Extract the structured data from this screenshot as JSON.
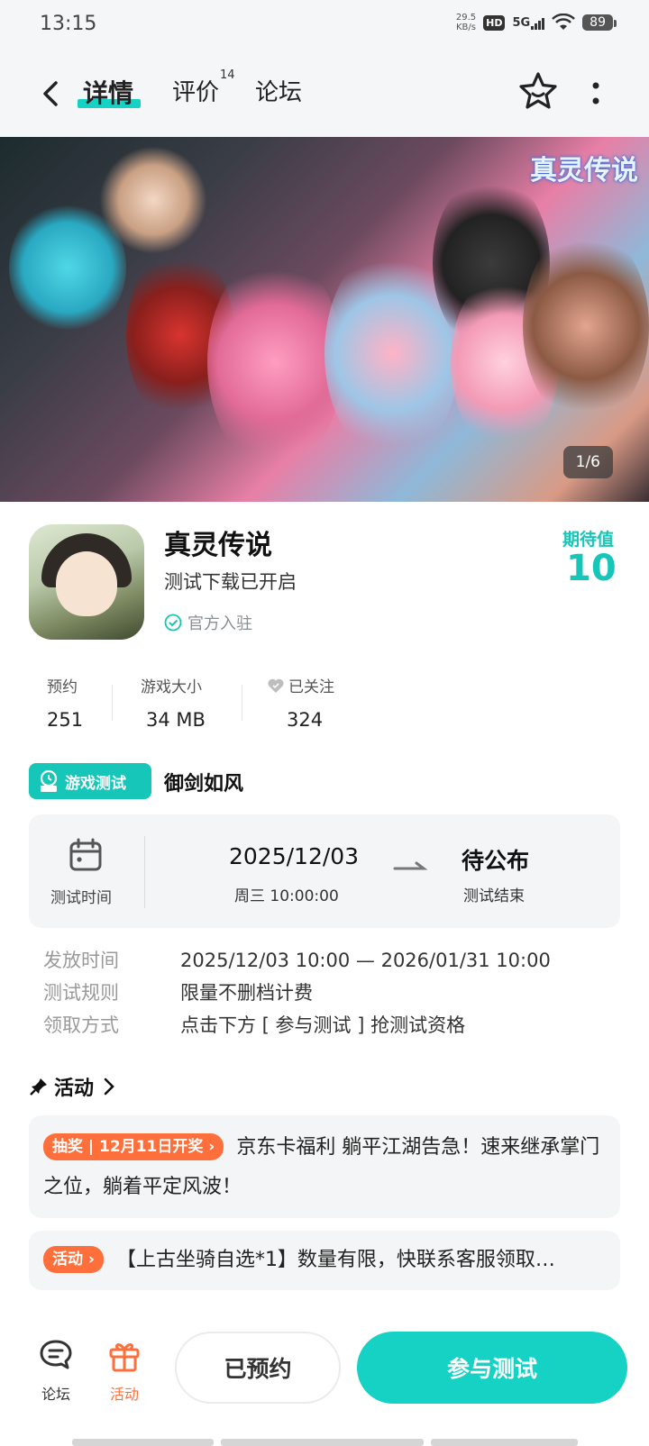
{
  "status_bar": {
    "time": "13:15",
    "speed_value": "29.5",
    "speed_unit": "KB/s",
    "hd": "HD",
    "network": "5G",
    "battery": "89"
  },
  "header": {
    "tabs": [
      {
        "label": "详情"
      },
      {
        "label": "评价",
        "count": "14"
      },
      {
        "label": "论坛"
      }
    ]
  },
  "banner": {
    "logo_text": "真灵传说",
    "counter": "1/6"
  },
  "app": {
    "name": "真灵传说",
    "subtitle": "测试下载已开启",
    "official": "官方入驻",
    "expect_label": "期待值",
    "expect_value": "10"
  },
  "stats": [
    {
      "label": "预约",
      "value": "251"
    },
    {
      "label": "游戏大小",
      "value": "34 MB"
    },
    {
      "label": "已关注",
      "value": "324"
    }
  ],
  "test": {
    "badge": "游戏测试",
    "name": "御剑如风",
    "time_label": "测试时间",
    "start_date": "2025/12/03",
    "start_detail": "周三  10:00:00",
    "end_main": "待公布",
    "end_sub": "测试结束",
    "info": [
      {
        "key": "发放时间",
        "value": "2025/12/03 10:00 — 2026/01/31 10:00"
      },
      {
        "key": "测试规则",
        "value": "限量不删档计费"
      },
      {
        "key": "领取方式",
        "value": "点击下方 [ 参与测试 ] 抢测试资格"
      }
    ]
  },
  "activity": {
    "title": "活动",
    "items": [
      {
        "tag": "抽奖 | 12月11日开奖",
        "text": "京东卡福利 躺平江湖告急！速来继承掌门之位，躺着平定风波！"
      },
      {
        "tag": "活动",
        "text": "【上古坐骑自选*1】数量有限，快联系客服领取…"
      }
    ]
  },
  "bottom_bar": {
    "forum_label": "论坛",
    "activity_label": "活动",
    "reserved_label": "已预约",
    "join_label": "参与测试"
  },
  "colors": {
    "accent": "#16d2c4",
    "accent_text": "#16c6b8",
    "orange": "#ff6f3c"
  }
}
